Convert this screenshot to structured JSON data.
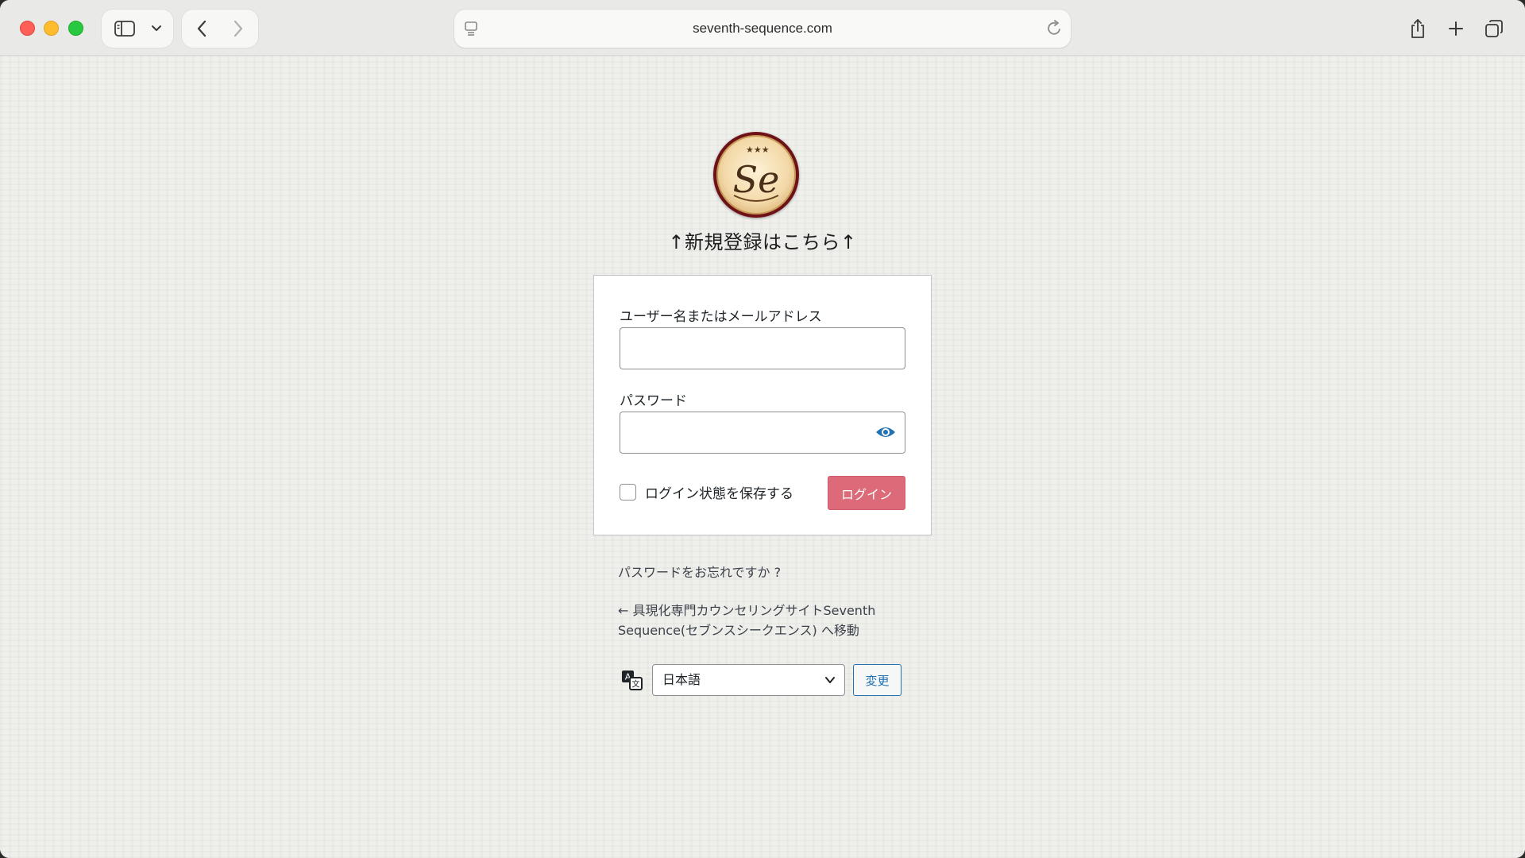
{
  "browser": {
    "url": "seventh-sequence.com"
  },
  "page": {
    "register_link": "↑新規登録はこちら↑",
    "logo": {
      "text": "Se"
    },
    "login_form": {
      "username_label": "ユーザー名またはメールアドレス",
      "username_value": "",
      "password_label": "パスワード",
      "password_value": "",
      "remember_label": "ログイン状態を保存する",
      "remember_checked": false,
      "submit_label": "ログイン"
    },
    "forgot_password": "パスワードをお忘れですか ?",
    "back_link_line1": "← 具現化専門カウンセリングサイトSeventh",
    "back_link_line2": "Sequence(セブンスシークエンス) へ移動",
    "language": {
      "selected": "日本語",
      "change_label": "変更"
    }
  },
  "colors": {
    "login_button": "#dd6a78",
    "change_button_border": "#2271b1",
    "logo_ring": "#6e1218"
  },
  "icons": [
    "sidebar-icon",
    "chevron-down-icon",
    "back-icon",
    "forward-icon",
    "page-settings-icon",
    "reload-icon",
    "share-icon",
    "new-tab-icon",
    "tab-overview-icon",
    "eye-icon",
    "translate-icon"
  ]
}
